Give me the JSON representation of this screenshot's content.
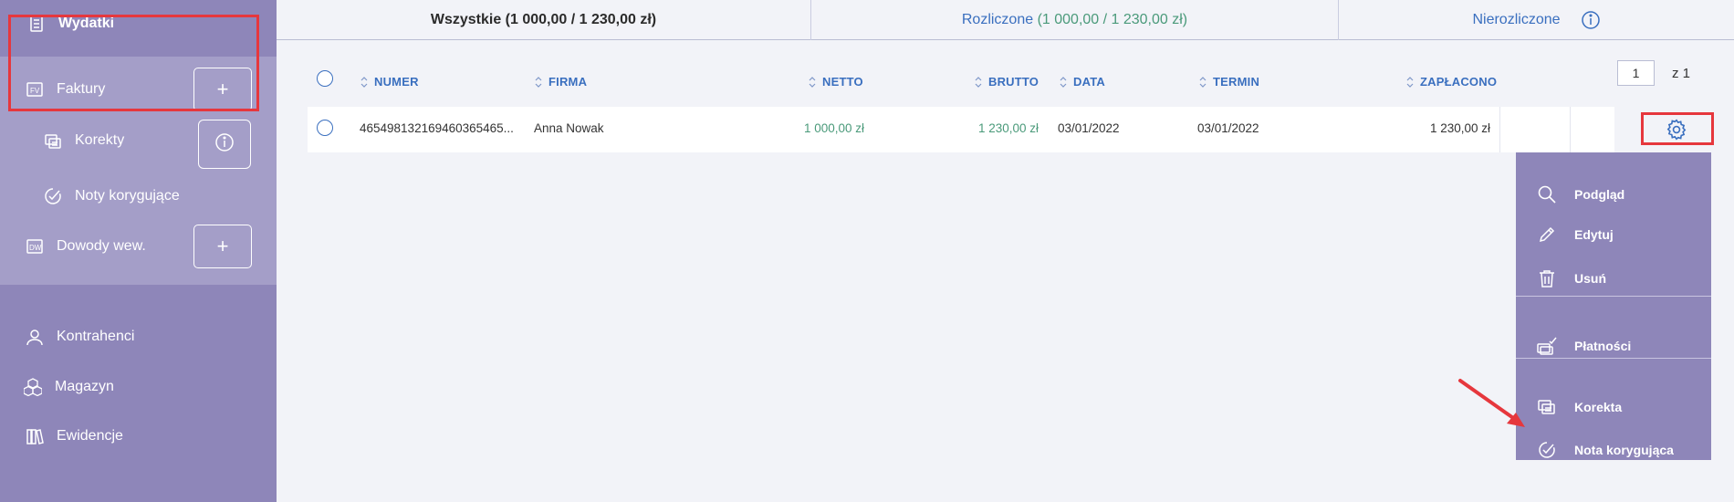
{
  "sidebar": {
    "section_title": "Wydatki",
    "items": [
      {
        "label": "Faktury",
        "icon": "invoice-icon"
      },
      {
        "label": "Korekty",
        "icon": "correction-icon"
      },
      {
        "label": "Noty korygujące",
        "icon": "check-note-icon"
      },
      {
        "label": "Dowody wew.",
        "icon": "internal-doc-icon"
      },
      {
        "label": "Kontrahenci",
        "icon": "user-icon"
      },
      {
        "label": "Magazyn",
        "icon": "boxes-icon"
      },
      {
        "label": "Ewidencje",
        "icon": "records-icon"
      }
    ],
    "plus_label": "+"
  },
  "tabs": {
    "all": "Wszystkie (1 000,00 / 1 230,00 zł)",
    "settled_label": "Rozliczone",
    "settled_values": " (1 000,00 / 1 230,00 zł)",
    "unsettled": "Nierozliczone"
  },
  "pager": {
    "page": "1",
    "of": "z 1"
  },
  "table": {
    "columns": [
      "NUMER",
      "FIRMA",
      "NETTO",
      "BRUTTO",
      "DATA",
      "TERMIN",
      "ZAPŁACONO"
    ],
    "rows": [
      {
        "numer": "465498132169460365465...",
        "firma": "Anna Nowak",
        "netto": "1 000,00 zł",
        "brutto": "1 230,00 zł",
        "data": "03/01/2022",
        "termin": "03/01/2022",
        "zaplacono": "1 230,00 zł"
      }
    ]
  },
  "menu": {
    "items": [
      {
        "label": "Podgląd",
        "icon": "search-icon"
      },
      {
        "label": "Edytuj",
        "icon": "pencil-icon"
      },
      {
        "label": "Usuń",
        "icon": "trash-icon"
      },
      {
        "label": "Płatności",
        "icon": "payments-icon"
      },
      {
        "label": "Korekta",
        "icon": "correction-icon"
      },
      {
        "label": "Nota korygująca",
        "icon": "check-note-icon"
      }
    ]
  },
  "colors": {
    "sidebar": "#8e86b9",
    "sidebar_sub": "#a49ec8",
    "accent_blue": "#3a6fbf",
    "accent_green": "#4a9a7a",
    "highlight_red": "#e6373d"
  }
}
